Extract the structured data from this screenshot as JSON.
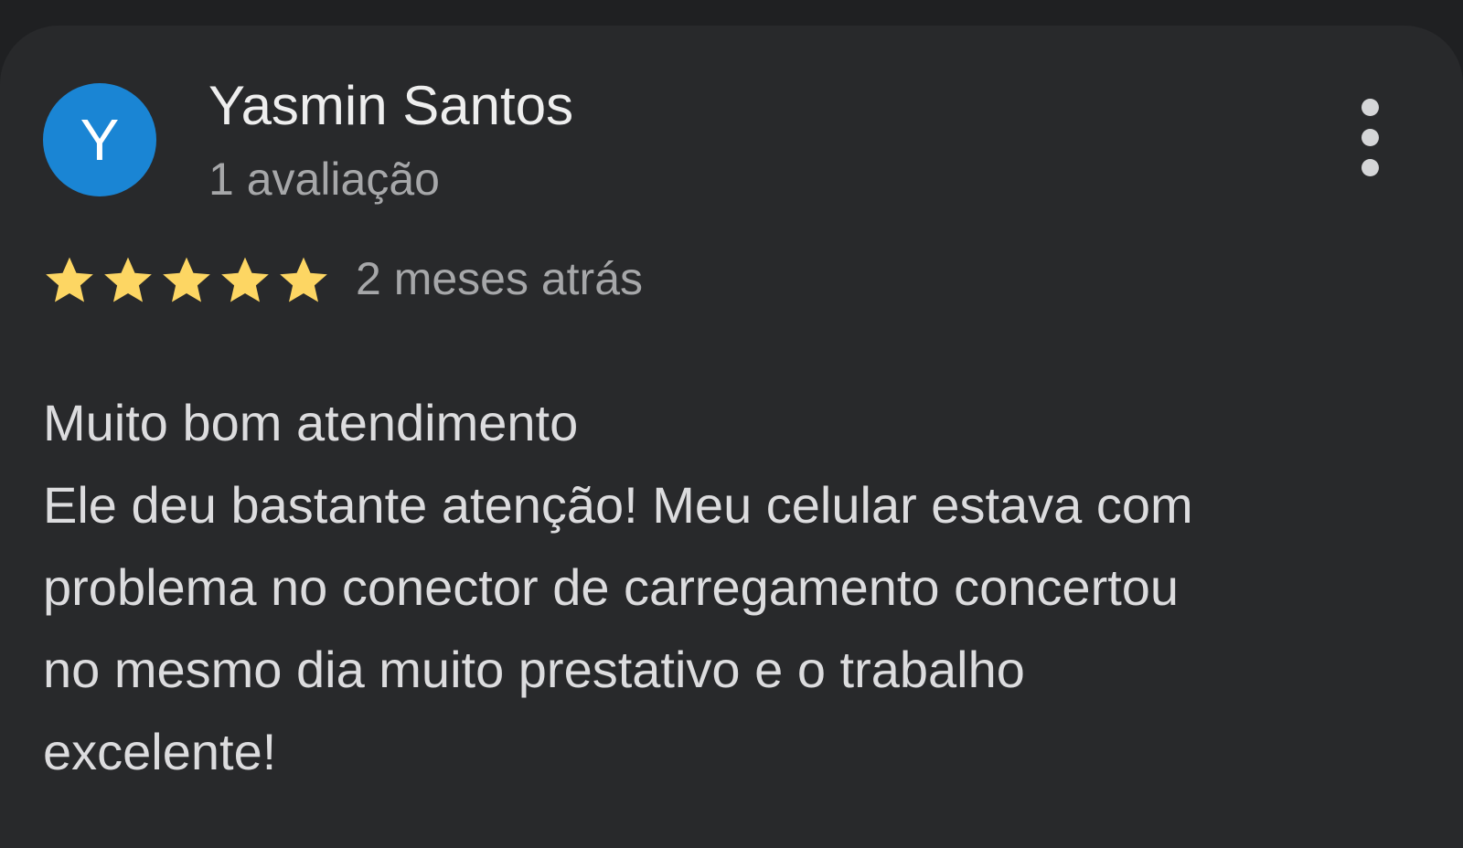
{
  "review": {
    "avatar_letter": "Y",
    "avatar_color": "#1a85d4",
    "reviewer_name": "Yasmin Santos",
    "review_count": "1 avaliação",
    "rating": 5,
    "rating_max": 5,
    "star_color": "#fdd663",
    "time_ago": "2 meses atrás",
    "text_lines": [
      "Muito bom atendimento",
      "Ele deu bastante atenção! Meu celular estava com",
      "problema no conector de carregamento concertou",
      "no mesmo dia muito prestativo e o trabalho",
      "excelente!"
    ],
    "menu_icon": "more-vert-icon"
  }
}
